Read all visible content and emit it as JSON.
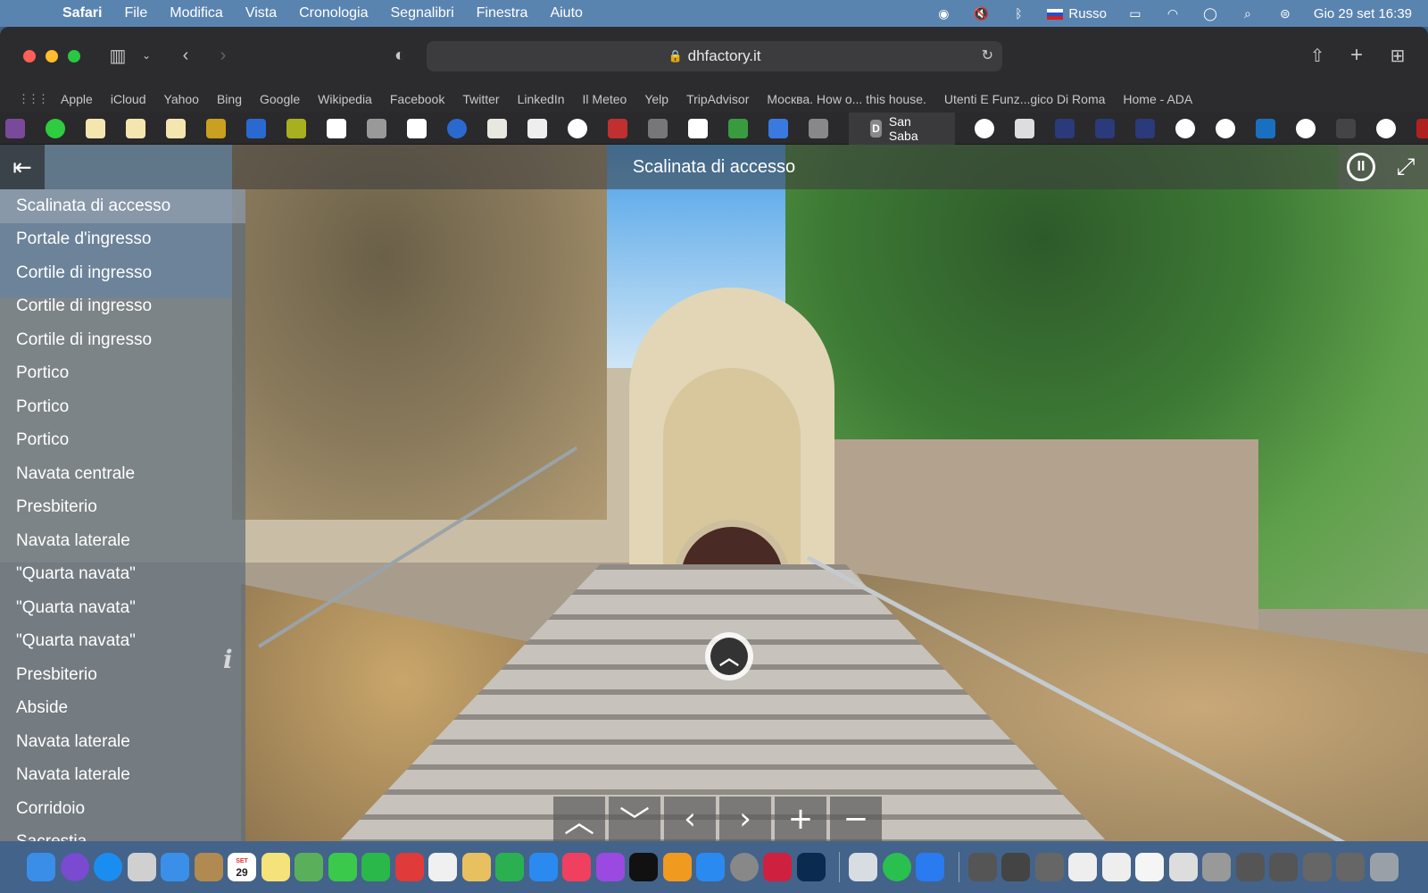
{
  "menubar": {
    "app_name": "Safari",
    "items": [
      "File",
      "Modifica",
      "Vista",
      "Cronologia",
      "Segnalibri",
      "Finestra",
      "Aiuto"
    ],
    "input_language": "Russo",
    "datetime": "Gio 29 set  16:39"
  },
  "browser": {
    "url": "dhfactory.it",
    "favorites": [
      "Apple",
      "iCloud",
      "Yahoo",
      "Bing",
      "Google",
      "Wikipedia",
      "Facebook",
      "Twitter",
      "LinkedIn",
      "Il Meteo",
      "Yelp",
      "TripAdvisor",
      "Москва. How o... this house.",
      "Utenti E Funz...gico Di Roma",
      "Home - ADA"
    ],
    "active_tab": {
      "icon_letter": "D",
      "title": "San Saba"
    }
  },
  "tour": {
    "title": "Scalinata di accesso",
    "scenes": [
      "Scalinata di accesso",
      "Portale d'ingresso",
      "Cortile di ingresso",
      "Cortile di ingresso",
      "Cortile di ingresso",
      "Portico",
      "Portico",
      "Portico",
      "Navata centrale",
      "Presbiterio",
      "Navata laterale",
      "\"Quarta navata\"",
      "\"Quarta navata\"",
      "\"Quarta navata\"",
      "Presbiterio",
      "Abside",
      "Navata laterale",
      "Navata laterale",
      "Corridoio",
      "Sacrestia"
    ],
    "active_scene_index": 0
  },
  "dock": {
    "calendar_day": "29",
    "calendar_month": "SET"
  }
}
